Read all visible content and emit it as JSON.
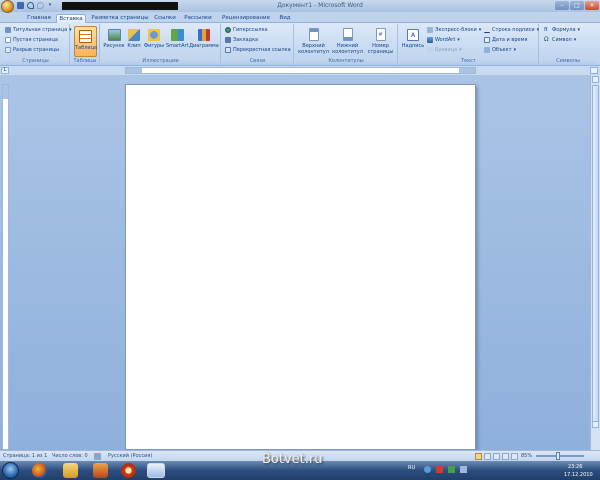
{
  "window": {
    "title": "Документ1 - Microsoft Word"
  },
  "tabs": [
    {
      "label": "Главная"
    },
    {
      "label": "Вставка"
    },
    {
      "label": "Разметка страницы"
    },
    {
      "label": "Ссылки"
    },
    {
      "label": "Рассылки"
    },
    {
      "label": "Рецензирование"
    },
    {
      "label": "Вид"
    }
  ],
  "ribbon": {
    "pages": {
      "label": "Страницы",
      "cover": "Титульная страница",
      "blank": "Пустая страница",
      "break": "Разрыв страницы"
    },
    "tables": {
      "label": "Таблицы",
      "table": "Таблица"
    },
    "illustrations": {
      "label": "Иллюстрации",
      "picture": "Рисунок",
      "clip": "Клип",
      "shapes": "Фигуры",
      "smartart": "SmartArt",
      "chart": "Диаграмма"
    },
    "links": {
      "label": "Связи",
      "hyperlink": "Гиперссылка",
      "bookmark": "Закладка",
      "crossref": "Перекрестная ссылка"
    },
    "headers": {
      "label": "Колонтитулы",
      "header_l1": "Верхний",
      "header_l2": "колонтитул",
      "footer_l1": "Нижний",
      "footer_l2": "колонтитул",
      "pagenum_l1": "Номер",
      "pagenum_l2": "страницы"
    },
    "text": {
      "label": "Текст",
      "textbox": "Надпись",
      "quickparts": "Экспресс-блоки",
      "wordart": "WordArt",
      "dropcap": "Буквица",
      "signature": "Строка подписи",
      "datetime": "Дата и время",
      "object": "Объект"
    },
    "symbols": {
      "label": "Символы",
      "formula": "Формула",
      "symbol": "Символ"
    }
  },
  "status": {
    "page": "Страница: 1 из 1",
    "words": "Число слов: 0",
    "language": "Русский (Россия)",
    "zoom": "85%"
  },
  "taskbar": {
    "language": "RU",
    "time": "23:26",
    "date": "17.12.2010"
  },
  "watermark": "Botvet.ru",
  "colors": {
    "ribbon": "#c8dbf2",
    "accent": "#15428b",
    "workspace": "#9fbbe1",
    "pressed": "#f8b25a"
  }
}
